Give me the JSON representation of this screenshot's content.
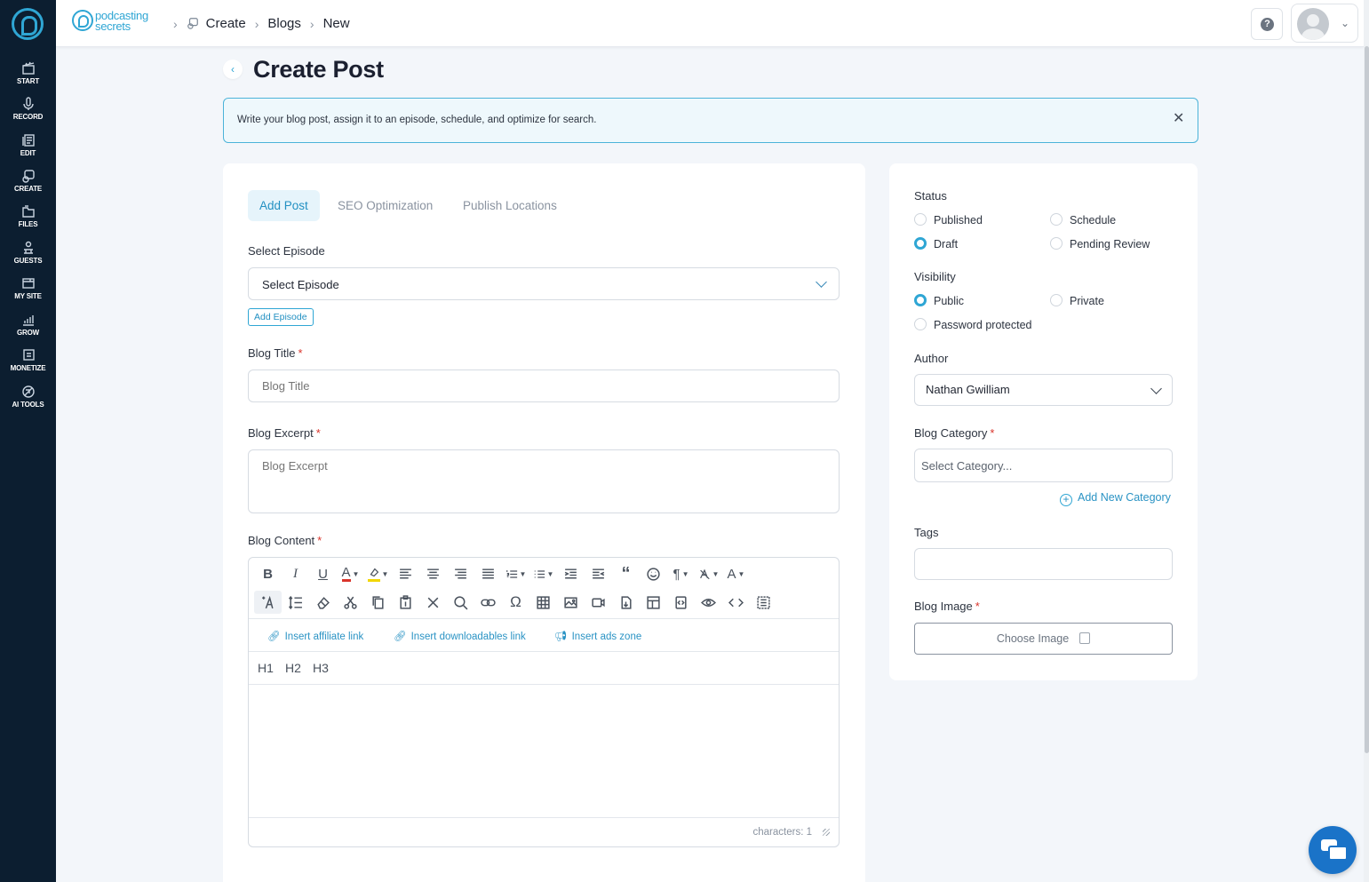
{
  "sidebar": {
    "items": [
      {
        "label": "START",
        "icon": "clapperboard-icon"
      },
      {
        "label": "RECORD",
        "icon": "microphone-icon"
      },
      {
        "label": "EDIT",
        "icon": "edit-document-icon"
      },
      {
        "label": "CREATE",
        "icon": "create-icon"
      },
      {
        "label": "FILES",
        "icon": "files-icon"
      },
      {
        "label": "GUESTS",
        "icon": "guests-icon"
      },
      {
        "label": "MY SITE",
        "icon": "site-icon"
      },
      {
        "label": "GROW",
        "icon": "growth-chart-icon"
      },
      {
        "label": "MONETIZE",
        "icon": "monetize-icon"
      },
      {
        "label": "AI TOOLS",
        "icon": "ai-tools-icon"
      }
    ]
  },
  "header": {
    "brand_top": "podcasting",
    "brand_bottom": "secrets",
    "breadcrumbs": [
      "Create",
      "Blogs",
      "New"
    ]
  },
  "page": {
    "title": "Create Post",
    "notice": "Write your blog post, assign it to an episode, schedule, and optimize for search."
  },
  "tabs": [
    "Add Post",
    "SEO Optimization",
    "Publish Locations"
  ],
  "form": {
    "episode_label": "Select Episode",
    "episode_value": "Select Episode",
    "add_episode": "Add Episode",
    "title_label": "Blog Title",
    "title_placeholder": "Blog Title",
    "excerpt_label": "Blog Excerpt",
    "excerpt_placeholder": "Blog Excerpt",
    "content_label": "Blog Content",
    "required_mark": "*"
  },
  "editor": {
    "links": [
      "Insert affiliate link",
      "Insert downloadables link",
      "Insert ads zone"
    ],
    "headings": [
      "H1",
      "H2",
      "H3"
    ],
    "char_count": "characters: 1"
  },
  "side": {
    "status_label": "Status",
    "status_options": [
      {
        "label": "Published",
        "checked": false
      },
      {
        "label": "Schedule",
        "checked": false
      },
      {
        "label": "Draft",
        "checked": true
      },
      {
        "label": "Pending Review",
        "checked": false
      }
    ],
    "visibility_label": "Visibility",
    "visibility_options": [
      {
        "label": "Public",
        "checked": true
      },
      {
        "label": "Private",
        "checked": false
      },
      {
        "label": "Password protected",
        "checked": false
      }
    ],
    "author_label": "Author",
    "author_value": "Nathan Gwilliam",
    "category_label": "Blog Category",
    "category_placeholder": "Select Category...",
    "add_category": "Add New Category",
    "tags_label": "Tags",
    "image_label": "Blog Image",
    "choose_image": "Choose Image"
  },
  "colors": {
    "accent": "#2fa6d4",
    "sidebar_bg": "#0c1e30",
    "required": "#d9342b"
  }
}
